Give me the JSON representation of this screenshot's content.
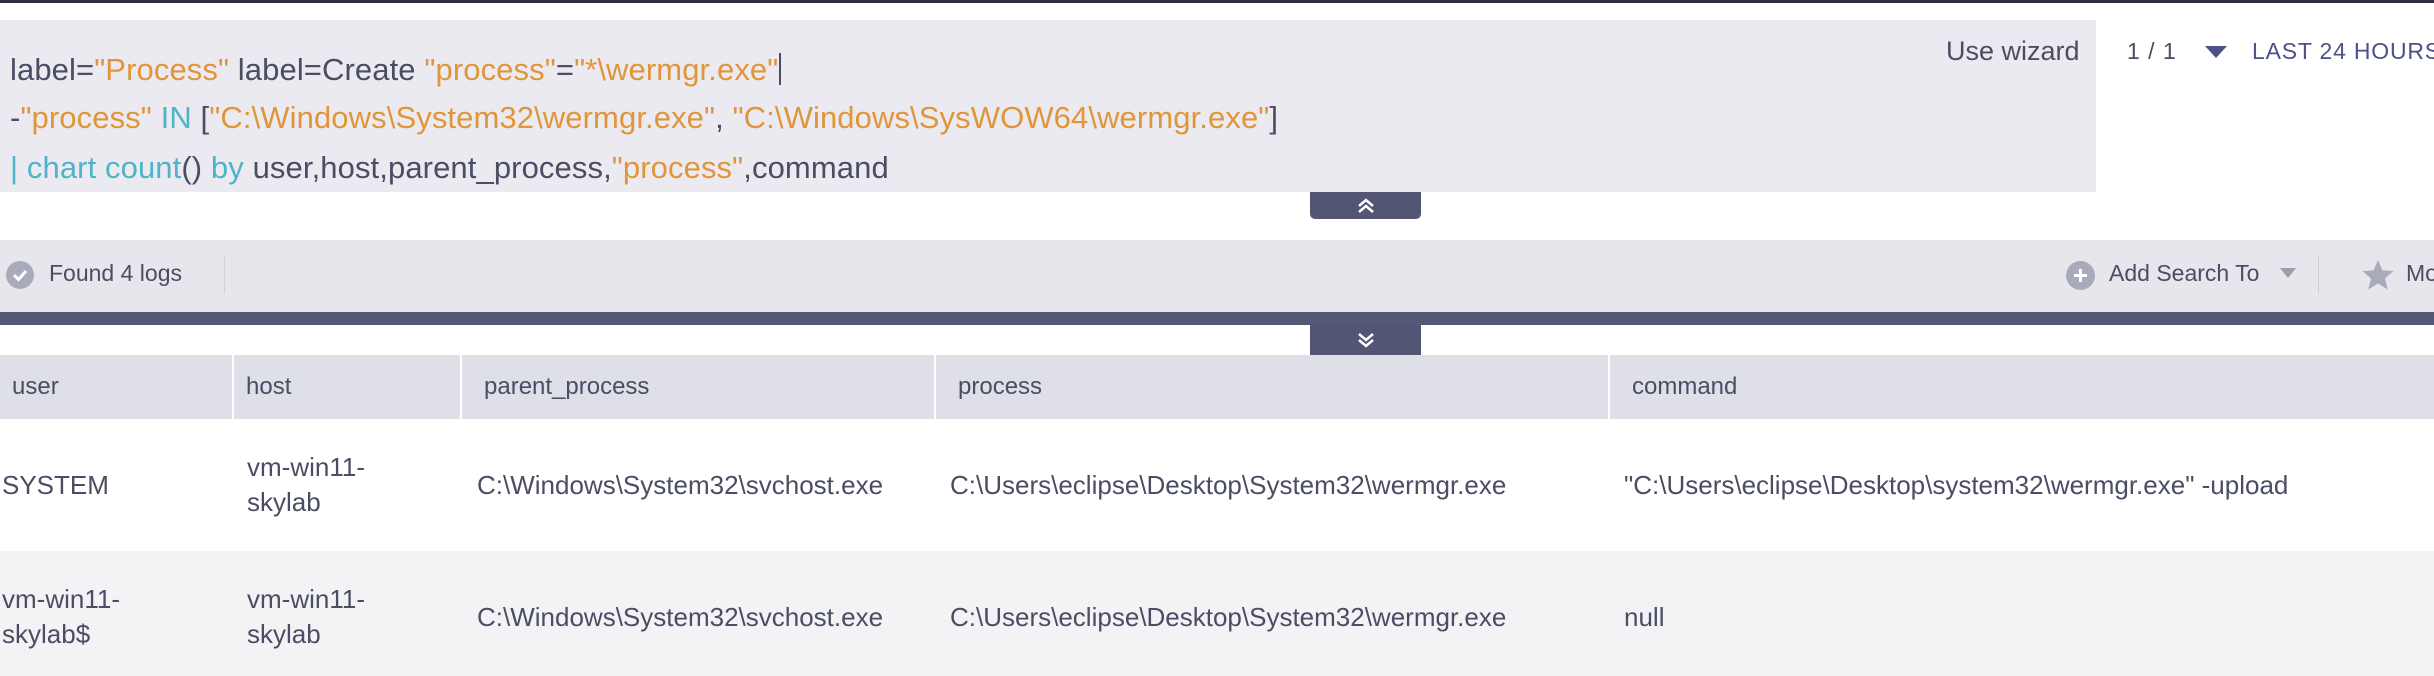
{
  "query": {
    "line1": {
      "t1": "label=",
      "t2": "\"Process\"",
      "t3": " label=Create ",
      "t4": "\"process\"",
      "t5": "=",
      "t6": "\"*\\wermgr.exe\""
    },
    "line2": {
      "t1": "-",
      "t2": "\"process\"",
      "t3": " IN ",
      "t4": "[",
      "t5": "\"C:\\Windows\\System32\\wermgr.exe\"",
      "t6": ", ",
      "t7": "\"C:\\Windows\\SysWOW64\\wermgr.exe\"",
      "t8": "]"
    },
    "line3": {
      "t1": "| ",
      "t2": "chart count",
      "t3": "() ",
      "t4": "by",
      "t5": " user,host,parent_process,",
      "t6": "\"process\"",
      "t7": ",command"
    },
    "wizard_label": "Use wizard"
  },
  "header": {
    "result_counter": "1 / 1",
    "time_range": "LAST 24 HOURS"
  },
  "toolbar": {
    "found": "Found 4 logs",
    "add_search": "Add Search To",
    "more": "More"
  },
  "table": {
    "columns": [
      "user",
      "host",
      "parent_process",
      "process",
      "command"
    ],
    "rows": [
      {
        "user": "SYSTEM",
        "host": "vm-win11-skylab",
        "parent_process": "C:\\Windows\\System32\\svchost.exe",
        "process": "C:\\Users\\eclipse\\Desktop\\System32\\wermgr.exe",
        "command": "\"C:\\Users\\eclipse\\Desktop\\system32\\wermgr.exe\" -upload"
      },
      {
        "user": "vm-win11-skylab$",
        "host": "vm-win11-skylab",
        "parent_process": "C:\\Windows\\System32\\svchost.exe",
        "process": "C:\\Users\\eclipse\\Desktop\\System32\\wermgr.exe",
        "command": "null"
      }
    ]
  },
  "icons": {
    "collapse_up": "double-chevron-up-icon",
    "collapse_down": "double-chevron-down-icon",
    "status": "check-circle-icon",
    "add": "plus-circle-icon",
    "favorite": "star-icon"
  },
  "colors": {
    "string_token": "#e1953a",
    "keyword_token": "#4fb3c9",
    "accent": "#525674",
    "time_range": "#4a5288"
  }
}
